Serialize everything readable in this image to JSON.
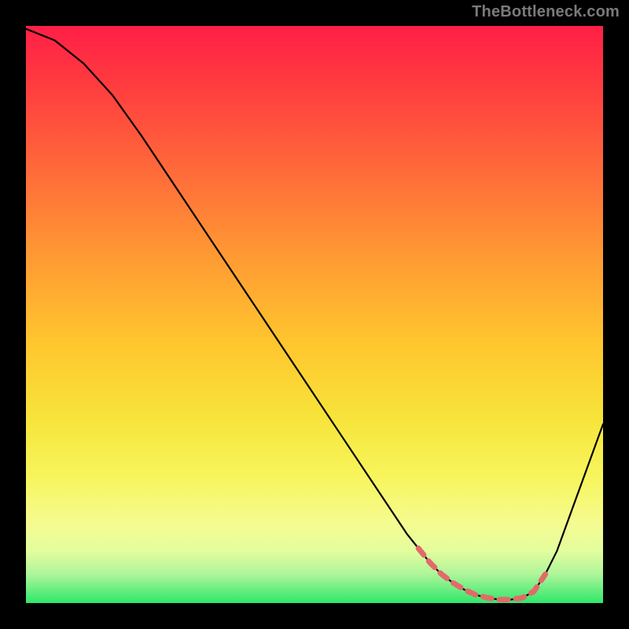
{
  "watermark": "TheBottleneck.com",
  "chart_data": {
    "type": "line",
    "title": "",
    "xlabel": "",
    "ylabel": "",
    "xlim": [
      0,
      100
    ],
    "ylim": [
      0,
      100
    ],
    "series": [
      {
        "name": "curve",
        "x": [
          0,
          5,
          10,
          15,
          20,
          25,
          30,
          35,
          40,
          45,
          50,
          55,
          60,
          62,
          64,
          66,
          68,
          70,
          72,
          74,
          76,
          78,
          80,
          82,
          84,
          86,
          88,
          90,
          92,
          94,
          96,
          98,
          100
        ],
        "y": [
          99.5,
          97.5,
          93.5,
          88.0,
          81.0,
          73.5,
          66.0,
          58.5,
          51.0,
          43.5,
          36.0,
          28.5,
          21.0,
          18.0,
          15.0,
          12.0,
          9.5,
          7.0,
          5.0,
          3.5,
          2.3,
          1.4,
          0.9,
          0.6,
          0.6,
          0.9,
          2.0,
          5.0,
          9.0,
          14.5,
          20.0,
          25.5,
          31.0
        ]
      }
    ],
    "highlight_segment": {
      "name": "flat-bottom-highlight",
      "color": "#e36a6a",
      "x": [
        68,
        70,
        72,
        74,
        76,
        78,
        80,
        82,
        84,
        86,
        88,
        90
      ],
      "y": [
        9.5,
        7.0,
        5.0,
        3.5,
        2.3,
        1.4,
        0.9,
        0.6,
        0.6,
        0.9,
        2.0,
        5.0
      ]
    }
  }
}
